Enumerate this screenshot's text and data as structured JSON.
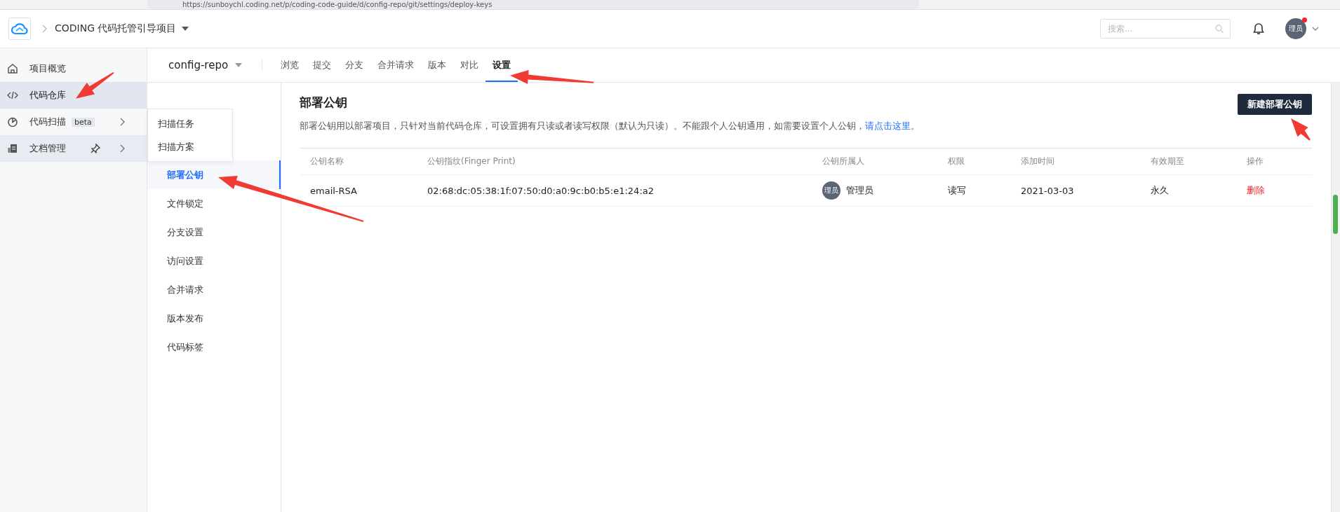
{
  "browser": {
    "url": "https://sunboychl.coding.net/p/coding-code-guide/d/config-repo/git/settings/deploy-keys"
  },
  "header": {
    "project": "CODING 代码托管引导项目",
    "search": {
      "placeholder": "搜索..."
    },
    "avatar": "理员",
    "notification": true
  },
  "sidebar": {
    "items": [
      {
        "label": "项目概览",
        "selected": false,
        "hovered": false,
        "annotated": false
      },
      {
        "label": "代码仓库",
        "selected": true,
        "hovered": false,
        "annotated": true
      },
      {
        "label": "代码扫描",
        "badge": "beta",
        "submenu": true,
        "selected": false,
        "hovered": false,
        "annotated": false
      },
      {
        "label": "文档管理",
        "submenu": true,
        "pinned": true,
        "selected": false,
        "hovered": true,
        "annotated": false
      }
    ]
  },
  "popup_menu": {
    "items": [
      "扫描任务",
      "扫描方案"
    ]
  },
  "repo": {
    "name": "config-repo",
    "tabs": [
      {
        "label": "浏览",
        "selected": false,
        "annotated": false
      },
      {
        "label": "提交",
        "selected": false,
        "annotated": false
      },
      {
        "label": "分支",
        "selected": false,
        "annotated": false
      },
      {
        "label": "合并请求",
        "selected": false,
        "annotated": false
      },
      {
        "label": "版本",
        "selected": false,
        "annotated": false
      },
      {
        "label": "对比",
        "selected": false,
        "annotated": false
      },
      {
        "label": "设置",
        "selected": true,
        "annotated": true
      }
    ]
  },
  "settings_nav": {
    "items": [
      {
        "label": "部署公钥",
        "selected": true,
        "annotated": true
      },
      {
        "label": "文件锁定",
        "selected": false,
        "annotated": false
      },
      {
        "label": "分支设置",
        "selected": false,
        "annotated": false
      },
      {
        "label": "访问设置",
        "selected": false,
        "annotated": false
      },
      {
        "label": "合并请求",
        "selected": false,
        "annotated": false
      },
      {
        "label": "版本发布",
        "selected": false,
        "annotated": false
      },
      {
        "label": "代码标签",
        "selected": false,
        "annotated": false
      }
    ]
  },
  "content": {
    "title": "部署公钥",
    "description": "部署公钥用以部署项目，只针对当前代码仓库，可设置拥有只读或者读写权限（默认为只读）。不能跟个人公钥通用，如需要设置个人公钥，",
    "link": "请点击这里",
    "description_end": "。",
    "button": {
      "label": "新建部署公钥",
      "annotated": true
    },
    "table": {
      "columns": [
        "公钥名称",
        "公钥指纹(Finger Print)",
        "公钥所属人",
        "权限",
        "添加时间",
        "有效期至",
        "操作"
      ],
      "rows": [
        {
          "name": "email-RSA",
          "fingerprint": "02:68:dc:05:38:1f:07:50:d0:a0:9c:b0:b5:e1:24:a2",
          "owner_avatar": "理员",
          "owner": "管理员",
          "permission": "读写",
          "added": "2021-03-03",
          "expires": "永久",
          "action": "删除"
        }
      ]
    }
  }
}
